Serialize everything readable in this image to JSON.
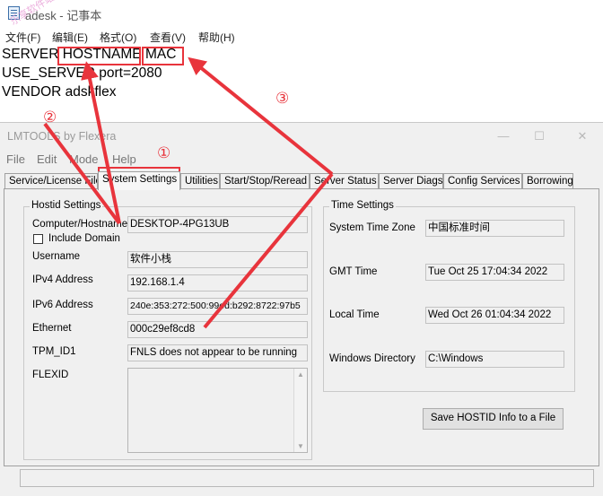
{
  "notepad": {
    "title": "adesk - 记事本",
    "menu": [
      "文件(F)",
      "编辑(E)",
      "格式(O)",
      "查看(V)",
      "帮助(H)"
    ],
    "watermark": "乐享软件站",
    "line1": {
      "a": "SERVER ",
      "b": "HOSTNAME",
      "c": " ",
      "d": "MAC"
    },
    "line2": "USE_SERVER port=2080",
    "line3": "VENDOR adskflex"
  },
  "lmtools": {
    "title": "LMTOOLS by Flexera",
    "menu": [
      "File",
      "Edit",
      "Mode",
      "Help"
    ],
    "tabs": [
      "Service/License File",
      "System Settings",
      "Utilities",
      "Start/Stop/Reread",
      "Server Status",
      "Server Diags",
      "Config Services",
      "Borrowing"
    ],
    "active_tab": "System Settings",
    "hostid": {
      "group_label": "Hostid Settings",
      "computer_hostname_label": "Computer/Hostname",
      "computer_hostname": "DESKTOP-4PG13UB",
      "include_domain_label": "Include Domain",
      "username_label": "Username",
      "username": "软件小栈",
      "ipv4_label": "IPv4 Address",
      "ipv4": "192.168.1.4",
      "ipv6_label": "IPv6 Address",
      "ipv6": "240e:353:272:500:99ed:b292:8722:97b5",
      "ethernet_label": "Ethernet",
      "ethernet": "000c29ef8cd8",
      "tpm_label": "TPM_ID1",
      "tpm": "FNLS does not appear to be running",
      "flexid_label": "FLEXID"
    },
    "time": {
      "group_label": "Time Settings",
      "tz_label": "System Time Zone",
      "tz": "中国标准时间",
      "gmt_label": "GMT Time",
      "gmt": "Tue Oct 25 17:04:34 2022",
      "local_label": "Local Time",
      "local": "Wed Oct 26 01:04:34 2022",
      "windir_label": "Windows Directory",
      "windir": "C:\\Windows"
    },
    "save_button": "Save HOSTID Info to a File"
  },
  "annotations": {
    "n1": "①",
    "n2": "②",
    "n3": "③",
    "color": "#e8343c"
  }
}
